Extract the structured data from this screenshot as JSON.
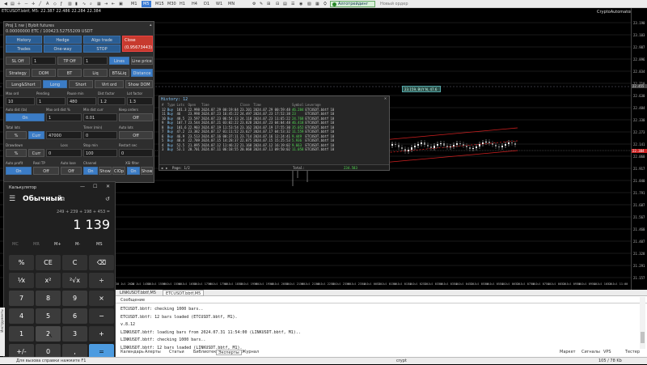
{
  "toolbar": {
    "timeframes": [
      "M1",
      "M5",
      "M15",
      "M30",
      "H1",
      "H4",
      "D1",
      "W1",
      "MN"
    ],
    "active_timeframe": "M5",
    "algo_label": "Алготрейдинг",
    "new_order": "Новый ордер"
  },
  "chart": {
    "title": "ETCUSDT.bbtf, M5: 22.387 22.486 22.284 22.384",
    "tag": "CryptoAutomator",
    "callout": "23.159, BUY N, 47.6",
    "prices": [
      "23.190",
      "23.103",
      "22.987",
      "22.896",
      "22.834",
      "22.710",
      "22.630",
      "22.484",
      "22.330",
      "22.273",
      "22.141",
      "22.060",
      "21.917",
      "21.840",
      "21.791",
      "21.687",
      "21.567",
      "21.460",
      "21.407",
      "21.328",
      "21.291",
      "21.157"
    ],
    "times": [
      "30 Jul 2024",
      "30 Jul 14:20",
      "30 Jul 15:00",
      "30 Jul 15:40",
      "30 Jul 16:20",
      "30 Jul 17:00",
      "30 Jul 17:40",
      "30 Jul 18:20",
      "30 Jul 19:00",
      "30 Jul 19:40",
      "30 Jul 20:20",
      "30 Jul 21:00",
      "30 Jul 21:40",
      "30 Jul 22:20",
      "30 Jul 23:00",
      "30 Jul 23:40",
      "31 Jul 00:20",
      "31 Jul 01:00",
      "31 Jul 01:40",
      "31 Jul 02:20",
      "31 Jul 03:00",
      "31 Jul 03:40",
      "31 Jul 04:20",
      "31 Jul 05:00",
      "31 Jul 05:40",
      "31 Jul 06:20",
      "31 Jul 07:00",
      "31 Jul 07:40",
      "31 Jul 08:20",
      "31 Jul 09:00",
      "31 Jul 09:40",
      "31 Jul 10:20",
      "31 Jul 11:00",
      "31 Jul 11:40"
    ],
    "current_price": "22.384",
    "level_price": "22.455"
  },
  "panel": {
    "header1": "Proj 1 nw | Bybit futures",
    "header2": "0.00000000 ETC / 100423.52755209 USDT",
    "buttons": {
      "history": "History",
      "hedge": "Hedge",
      "algo": "Algo trade",
      "close": "Close",
      "close_sub": "(0.95673443)",
      "trades": "Trades",
      "oneway": "One-way",
      "stop": "STOP",
      "sl_off": "SL Off",
      "sl_val": "1",
      "tp_off": "TP Off",
      "tp_val": "1",
      "lines": "Lines",
      "line_price": "Line price",
      "strategy": "Strategy",
      "dom": "DOM",
      "bt": "BT",
      "liq": "Liq",
      "btliq": "BT&Liq",
      "distance": "Distance",
      "longshort": "Long&Short",
      "long": "Long",
      "short": "Short",
      "virt": "Virt ord",
      "showdom": "Show DOM"
    },
    "row1_labels": [
      "Max ord",
      "Pending",
      "Pause min",
      "Dist factor",
      "Lot factor"
    ],
    "row1_values": [
      "10",
      "1",
      "480",
      "1.2",
      "1.3"
    ],
    "row2_labels": [
      "Auto dist (ta)",
      "Max ord dist %",
      "Min dist curr",
      "Keep orders"
    ],
    "row2_values": [
      "On",
      "1",
      "0.01",
      "Off"
    ],
    "row3_labels": [
      "Total lots",
      "Timer (min)",
      "Auto lots"
    ],
    "row3_values": [
      "%",
      "Curr",
      "47000",
      "0",
      "Off"
    ],
    "row4_labels": [
      "Drawdown",
      "Loss",
      "Stop min",
      "Restart sec"
    ],
    "row4_values": [
      "%",
      "Curr",
      "0",
      "100",
      "0"
    ],
    "row5_labels": [
      "Auto profit",
      "Real TP",
      "Auto lose",
      "Channel",
      "XSI filter"
    ],
    "row5_values": [
      "On",
      "Off",
      "Off",
      "On",
      "Show",
      "ClOp",
      "On",
      "Show"
    ]
  },
  "history": {
    "title": "History: 12",
    "columns": [
      "#",
      "Type",
      "Lots",
      "Open",
      "Time",
      "Close",
      "Time",
      "Symbol",
      "Leverage"
    ],
    "rows": [
      [
        "12",
        "Buy",
        "181.3",
        "22.998",
        "2024.07.29 00:19:04",
        "23.201",
        "2024.07.29 00:59:48",
        "46.284",
        "ETCUSDT.bbtf",
        "10"
      ],
      [
        "11",
        "Buy",
        "46",
        "23.998",
        "2024.07.23 16:45:22",
        "24.497",
        "2024.07.23 17:52:38",
        "23",
        "ETCUSDT.bbtf",
        "10"
      ],
      [
        "10",
        "Buy",
        "40.5",
        "23.597",
        "2024.07.23 06:54:13",
        "24.118",
        "2024.07.23 11:65:22",
        "24.768",
        "ETCUSDT.bbtf",
        "10"
      ],
      [
        "9",
        "Buy",
        "107.7",
        "23.544",
        "2024.07.21 03:02:22",
        "23.828",
        "2024.07.23 04:04:48",
        "46.418",
        "ETCUSDT.bbtf",
        "10"
      ],
      [
        "8",
        "Buy",
        "101.6",
        "22.903",
        "2024.07.19 11:53:54",
        "23.162",
        "2024.07.19 17:55:30",
        "35.052",
        "ETCUSDT.bbtf",
        "10"
      ],
      [
        "7",
        "Buy",
        "47.2",
        "23.382",
        "2024.07.17 01:11:52",
        "23.627",
        "2024.07.17 04:53:32",
        "11.559",
        "ETCUSDT.bbtf",
        "10"
      ],
      [
        "6",
        "Buy",
        "46.9",
        "23.513",
        "2024.07.16 00:37:11",
        "23.714",
        "2024.07.16 12:24:41",
        "9.449",
        "ETCUSDT.bbtf",
        "10"
      ],
      [
        "5",
        "Buy",
        "48.4",
        "22.789",
        "2024.07.15 14:28:37",
        "22.875",
        "2024.07.15 15:25:53",
        "5.936",
        "ETCUSDT.bbtf",
        "10"
      ],
      [
        "4",
        "Buy",
        "52.5",
        "21.895",
        "2024.07.12 11:46:22",
        "21.168",
        "2024.07.12 16:19:02",
        "9.663",
        "ETCUSDT.bbtf",
        "10"
      ],
      [
        "3",
        "Buy",
        "53.1",
        "20.701",
        "2024.07.11 06:18:55",
        "20.868",
        "2024.07.11 09:50:02",
        "11.058",
        "ETCUSDT.bbtf",
        "10"
      ]
    ],
    "footer_page": "Page: 1/2",
    "footer_total_label": "Total:",
    "footer_total": "234.583"
  },
  "calculator": {
    "app": "Калькулятор",
    "mode": "Обычный",
    "expression": "249 + 239 + 198 + 453 =",
    "result": "1 139",
    "memory": [
      "MC",
      "MR",
      "M+",
      "M-",
      "MS"
    ],
    "keys": [
      [
        "%",
        "CE",
        "C",
        "⌫"
      ],
      [
        "⅟x",
        "x²",
        "²√x",
        "÷"
      ],
      [
        "7",
        "8",
        "9",
        "×"
      ],
      [
        "4",
        "5",
        "6",
        "−"
      ],
      [
        "1",
        "2",
        "3",
        "+"
      ],
      [
        "+/-",
        "0",
        ",",
        "="
      ]
    ]
  },
  "toolbox": {
    "doc_tabs": [
      "LINKUSDT.bbtf,M5",
      "ETCUSDT.bbtf,M5"
    ],
    "header": "Сообщение",
    "log": [
      "ETCUSDT.bbtf: checking 1000 bars..",
      "ETCUSDT.bbtf: 12 bars loaded (ETCUSDT.bbtf, M1).",
      "v.8.12",
      "LINKUSDT.bbtf: loading bars from 2024.07.31 11:54:00 (LINKUSDT.bbtf, M1)..",
      "LINKUSDT.bbtf: checking 1000 bars..",
      "LINKUSDT.bbtf: 12 bars loaded (LINKUSDT.bbtf, M1)."
    ],
    "tabs": [
      "Календарь",
      "Алерты",
      "Статьи",
      "Библиотека",
      "Эксперты",
      "Журнал"
    ],
    "active_tab": "Эксперты",
    "right_items": [
      "Маркет",
      "Сигналы",
      "VPS",
      "Тестер"
    ]
  },
  "status": {
    "help": "Для вызова справки нажмите F1",
    "profile": "crypt",
    "traffic": "105 / 78 Kb",
    "side": "Инструменты"
  },
  "colors": {
    "accent": "#3a7bd5",
    "channel": "#d02020",
    "candle_up": "#e8e8e8",
    "candle_down": "#8a8a8a",
    "grid": "#1a1a1a"
  }
}
